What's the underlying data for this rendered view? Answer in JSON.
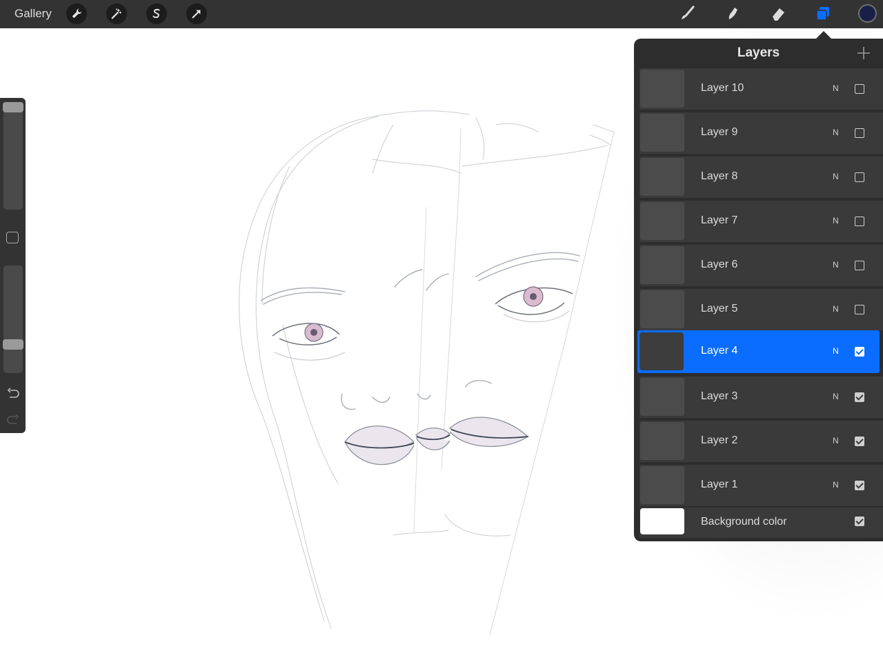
{
  "toolbar": {
    "gallery_label": "Gallery",
    "left_tools": [
      {
        "name": "actions-wrench-icon"
      },
      {
        "name": "adjustments-magic-wand-icon"
      },
      {
        "name": "selection-icon"
      },
      {
        "name": "transform-arrow-icon"
      }
    ],
    "right_tools": [
      {
        "name": "brush-icon"
      },
      {
        "name": "smudge-icon"
      },
      {
        "name": "eraser-icon"
      },
      {
        "name": "layers-icon",
        "active": true
      }
    ],
    "active_color": "#1a1f4a",
    "accent_color": "#0a6dff"
  },
  "layers_panel": {
    "title": "Layers",
    "add_icon": "plus-icon",
    "layers": [
      {
        "name": "Layer 10",
        "mode": "N",
        "visible": false,
        "selected": false
      },
      {
        "name": "Layer 9",
        "mode": "N",
        "visible": false,
        "selected": false
      },
      {
        "name": "Layer 8",
        "mode": "N",
        "visible": false,
        "selected": false
      },
      {
        "name": "Layer 7",
        "mode": "N",
        "visible": false,
        "selected": false
      },
      {
        "name": "Layer 6",
        "mode": "N",
        "visible": false,
        "selected": false
      },
      {
        "name": "Layer 5",
        "mode": "N",
        "visible": false,
        "selected": false
      },
      {
        "name": "Layer 4",
        "mode": "N",
        "visible": true,
        "selected": true
      },
      {
        "name": "Layer 3",
        "mode": "N",
        "visible": true,
        "selected": false
      },
      {
        "name": "Layer 2",
        "mode": "N",
        "visible": true,
        "selected": false
      },
      {
        "name": "Layer 1",
        "mode": "N",
        "visible": true,
        "selected": false
      }
    ],
    "background": {
      "name": "Background color",
      "visible": true,
      "color": "#ffffff"
    }
  },
  "sidebar": {
    "brush_size_level": 1.0,
    "opacity_level": 0.1,
    "undo_icon": "undo-icon",
    "redo_icon": "redo-icon"
  }
}
